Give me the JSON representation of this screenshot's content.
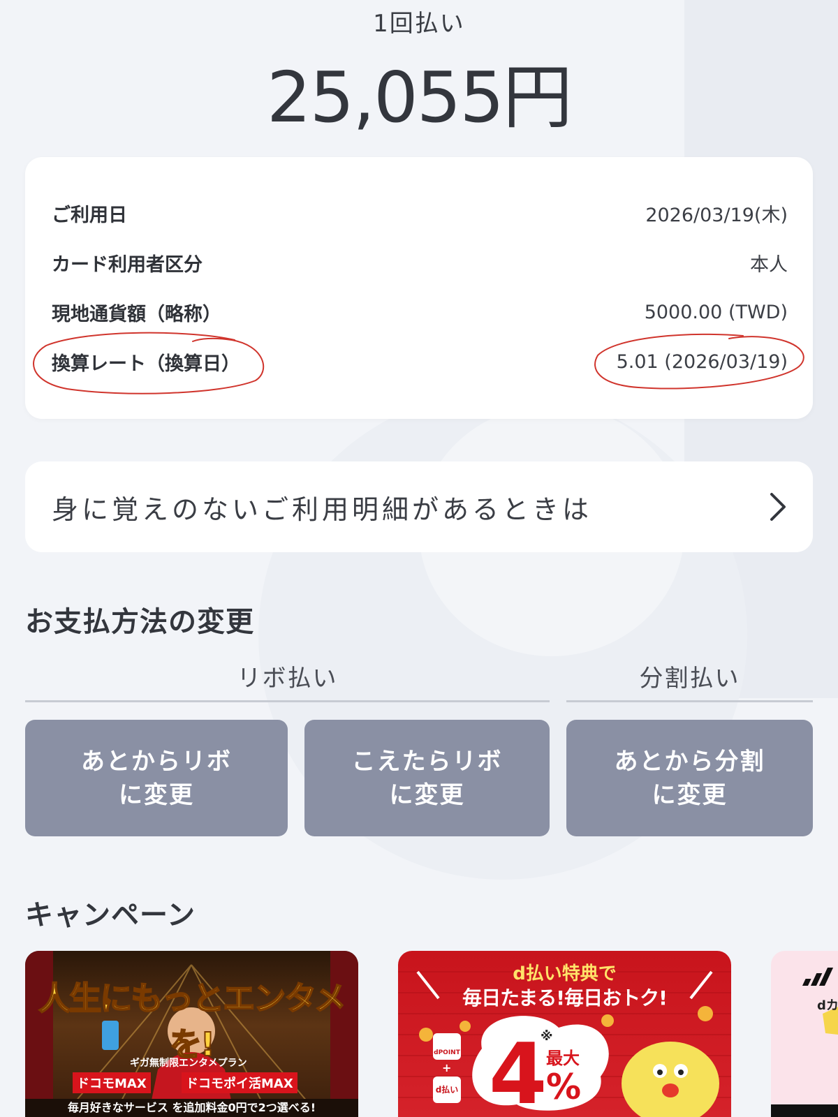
{
  "summary": {
    "payment_type": "1回払い",
    "amount": "25,055円"
  },
  "details": [
    {
      "label": "ご利用日",
      "value": "2026/03/19(木)"
    },
    {
      "label": "カード利用者区分",
      "value": "本人"
    },
    {
      "label": "現地通貨額（略称）",
      "value": "5000.00 (TWD)"
    },
    {
      "label": "換算レート（換算日）",
      "value": "5.01 (2026/03/19)"
    }
  ],
  "report_link": {
    "text": "身に覚えのないご利用明細があるときは"
  },
  "payment_change": {
    "title": "お支払方法の変更",
    "tabs": [
      "リボ払い",
      "分割払い"
    ],
    "buttons": [
      {
        "line1": "あとからリボ",
        "line2": "に変更"
      },
      {
        "line1": "こえたらリボ",
        "line2": "に変更"
      },
      {
        "line1": "あとから分割",
        "line2": "に変更"
      }
    ]
  },
  "campaign": {
    "title": "キャンペーン",
    "banners": [
      {
        "headline": "人生にもっとエンタメを!",
        "sub": "ギガ無制限エンタメプラン",
        "plan_a": "ドコモMAX",
        "plan_b": "ドコモポイ活MAX",
        "footer": "毎月好きなサービス を追加料金0円で2つ選べる!"
      },
      {
        "headline_1": "d払い特典で",
        "headline_2": "毎日たまる!毎日おトク!",
        "badge_top": "dPOINT",
        "badge_bottom": "d払い",
        "percent_prefix": "最大",
        "percent_value": "4",
        "percent_sign": "%",
        "note": "※"
      },
      {
        "partial_text": "dカ"
      }
    ]
  },
  "colors": {
    "background": "#f2f4f8",
    "card": "#ffffff",
    "button": "#8a90a4",
    "annotation": "#d0342c"
  }
}
